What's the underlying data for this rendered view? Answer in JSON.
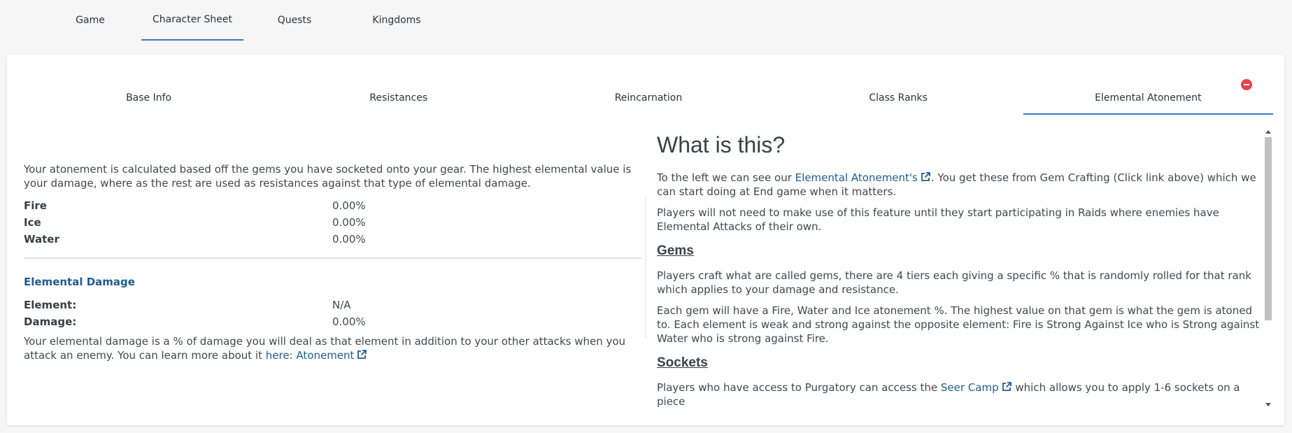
{
  "top_tabs": [
    "Game",
    "Character Sheet",
    "Quests",
    "Kingdoms"
  ],
  "inner_tabs": [
    "Base Info",
    "Resistances",
    "Reincarnation",
    "Class Ranks",
    "Elemental Atonement"
  ],
  "left": {
    "intro": "Your atonement is calculated based off the gems you have socketed onto your gear. The highest elemental value is your damage, where as the rest are used as resistances against that type of elemental damage.",
    "atonements": [
      {
        "label": "Fire",
        "value": "0.00%"
      },
      {
        "label": "Ice",
        "value": "0.00%"
      },
      {
        "label": "Water",
        "value": "0.00%"
      }
    ],
    "damage_title": "Elemental Damage",
    "damage": [
      {
        "label": "Element:",
        "value": "N/A"
      },
      {
        "label": "Damage:",
        "value": "0.00%"
      }
    ],
    "damage_note": "Your elemental damage is a % of damage you will deal as that element in addition to your other attacks when you attack an enemy. You can learn more about it",
    "damage_link": "here: Atonement"
  },
  "right": {
    "title": "What is this?",
    "p1_before": "To the left we can see our",
    "p1_link": "Elemental Atonement's",
    "p1_after": ". You get these from Gem Crafting (Click link above) which we can start doing at End game when it matters.",
    "p2": "Players will not need to make use of this feature until they start participating in Raids where enemies have Elemental Attacks of their own.",
    "gems_heading": "Gems",
    "p3": "Players craft what are called gems, there are 4 tiers each giving a specific % that is randomly rolled for that rank which applies to your damage and resistance.",
    "p4": "Each gem will have a Fire, Water and Ice atonement %. The highest value on that gem is what the gem is atoned to. Each element is weak and strong against the opposite element: Fire is Strong Against Ice who is Strong against Water who is strong against Fire.",
    "sockets_heading": "Sockets",
    "p5_before": "Players who have access to Purgatory can access the",
    "p5_link": "Seer Camp",
    "p5_after": "which allows you to apply 1-6 sockets on a piece"
  },
  "icons": {
    "external_link": "external-link-icon",
    "close": "remove-circle-icon"
  },
  "colors": {
    "accent": "#3a79c9",
    "link": "#1f5b91",
    "close": "#e5424d"
  }
}
